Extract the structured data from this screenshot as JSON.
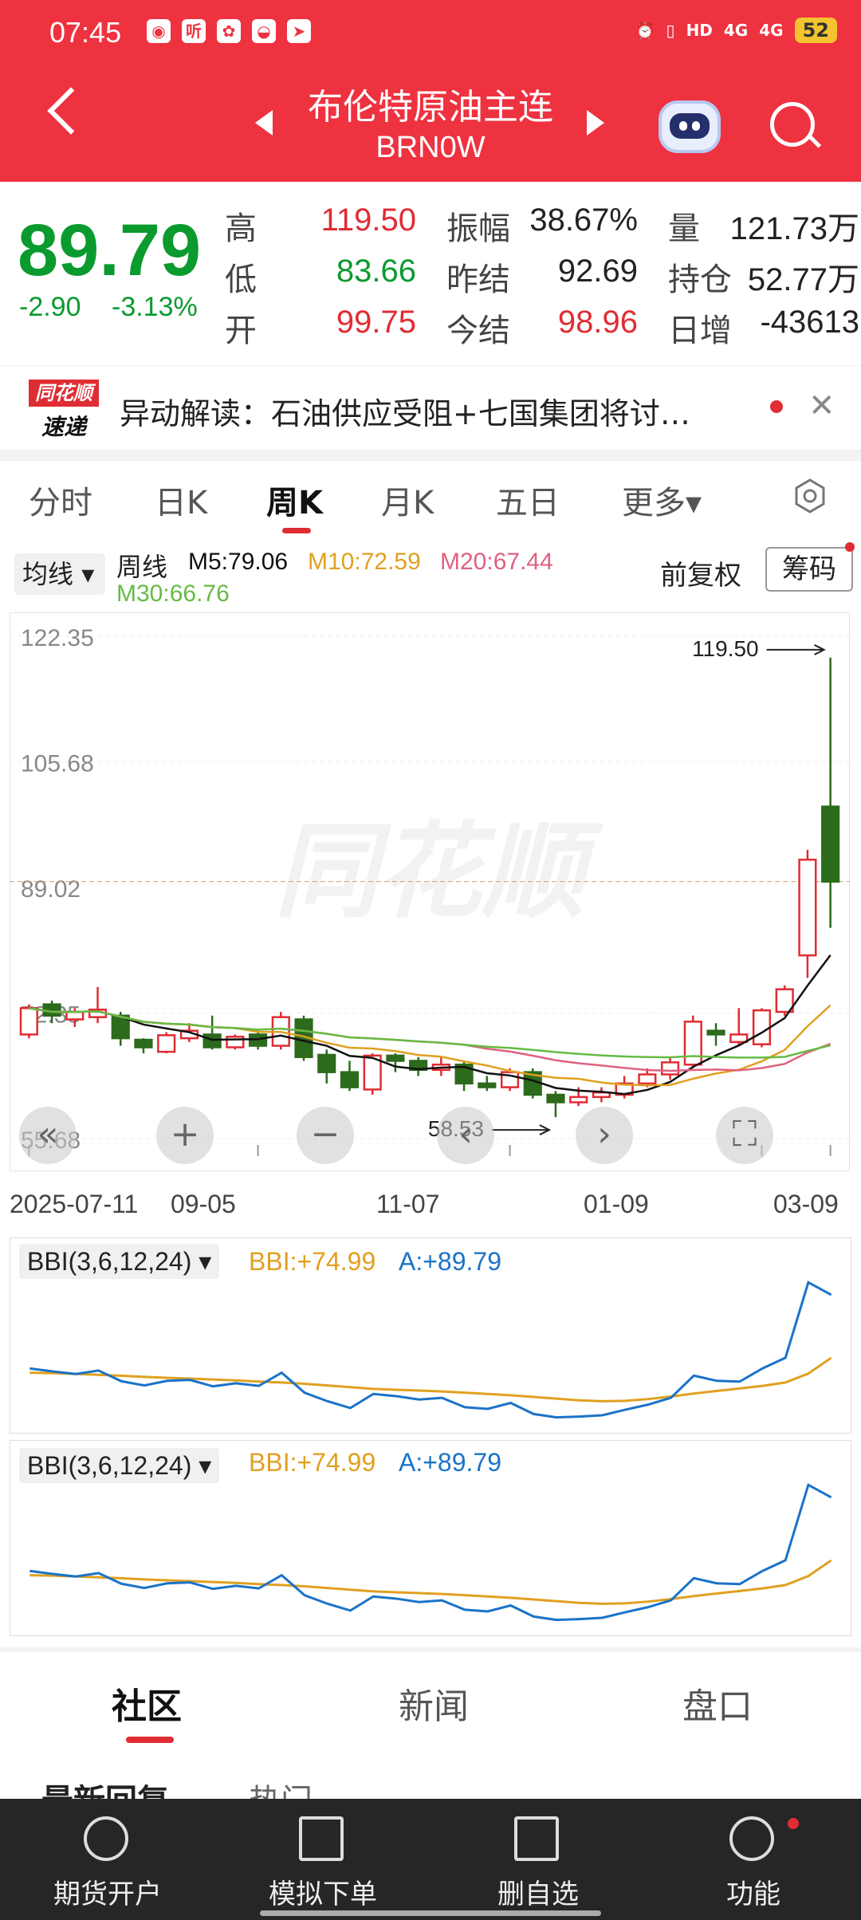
{
  "status_bar": {
    "time": "07:45",
    "battery": "52",
    "signal1": "4G",
    "signal2": "4G",
    "hd": "HD"
  },
  "header": {
    "title": "布伦特原油主连",
    "subtitle": "BRN0W"
  },
  "quote": {
    "price": "89.79",
    "change": "-2.90",
    "change_pct": "-3.13%",
    "fields": [
      {
        "label": "高",
        "value": "119.50",
        "color": "red"
      },
      {
        "label": "振幅",
        "value": "38.67%",
        "color": "black"
      },
      {
        "label": "量",
        "value": "121.73万",
        "color": "black"
      },
      {
        "label": "低",
        "value": "83.66",
        "color": "green"
      },
      {
        "label": "昨结",
        "value": "92.69",
        "color": "black"
      },
      {
        "label": "持仓",
        "value": "52.77万",
        "color": "black"
      },
      {
        "label": "开",
        "value": "99.75",
        "color": "red"
      },
      {
        "label": "今结",
        "value": "98.96",
        "color": "red"
      },
      {
        "label": "日增",
        "value": "-43613",
        "color": "black"
      }
    ]
  },
  "news": {
    "logo_top": "同花顺",
    "logo_bottom": "速递",
    "text": "异动解读：石油供应受阻+七国集团将讨…"
  },
  "tabs": [
    "分时",
    "日K",
    "周K",
    "月K",
    "五日",
    "更多▾"
  ],
  "active_tab": "周K",
  "ma_bar": {
    "button": "均线",
    "period": "周线",
    "m5": "M5:79.06",
    "m10": "M10:72.59",
    "m20": "M20:67.44",
    "m30": "M30:66.76",
    "adjust": "前复权",
    "chip": "筹码"
  },
  "colors": {
    "up": "#e02c33",
    "down": "#2c6a1c",
    "m5": "#111111",
    "m10": "#e0a020",
    "m20": "#e06080",
    "m30": "#66bb44",
    "bbi": "#e0a020",
    "a": "#1a73c8",
    "header": "#ee3240"
  },
  "chart_data": [
    {
      "type": "candlestick",
      "y_ticks": [
        "122.35",
        "105.68",
        "89.02",
        "72.35",
        "55.68"
      ],
      "ylim": [
        55.68,
        122.35
      ],
      "x_labels": [
        "2025-07-11",
        "09-05",
        "11-07",
        "01-09",
        "03-09"
      ],
      "max_label": "119.50",
      "min_label": "58.53",
      "candles": [
        {
          "o": 69.5,
          "c": 73.0,
          "h": 73.5,
          "l": 69.0
        },
        {
          "o": 73.5,
          "c": 72.0,
          "h": 74.0,
          "l": 71.0
        },
        {
          "o": 71.5,
          "c": 72.5,
          "h": 73.0,
          "l": 70.5
        },
        {
          "o": 71.8,
          "c": 72.8,
          "h": 75.8,
          "l": 71.0
        },
        {
          "o": 72.0,
          "c": 69.0,
          "h": 72.5,
          "l": 68.0
        },
        {
          "o": 68.8,
          "c": 67.8,
          "h": 69.0,
          "l": 67.0
        },
        {
          "o": 67.2,
          "c": 69.4,
          "h": 69.8,
          "l": 67.0
        },
        {
          "o": 69.0,
          "c": 70.0,
          "h": 71.0,
          "l": 68.5
        },
        {
          "o": 69.5,
          "c": 67.8,
          "h": 72.0,
          "l": 67.5
        },
        {
          "o": 67.8,
          "c": 69.2,
          "h": 69.5,
          "l": 67.5
        },
        {
          "o": 69.5,
          "c": 68.0,
          "h": 70.0,
          "l": 67.5
        },
        {
          "o": 68.0,
          "c": 71.8,
          "h": 72.5,
          "l": 67.5
        },
        {
          "o": 71.5,
          "c": 66.5,
          "h": 72.0,
          "l": 66.0
        },
        {
          "o": 66.8,
          "c": 64.5,
          "h": 67.5,
          "l": 63.0
        },
        {
          "o": 64.5,
          "c": 62.5,
          "h": 66.0,
          "l": 62.0
        },
        {
          "o": 62.2,
          "c": 66.7,
          "h": 67.0,
          "l": 61.5
        },
        {
          "o": 66.7,
          "c": 66.0,
          "h": 67.0,
          "l": 64.5
        },
        {
          "o": 66.0,
          "c": 64.8,
          "h": 66.5,
          "l": 64.0
        },
        {
          "o": 64.8,
          "c": 65.5,
          "h": 66.5,
          "l": 64.0
        },
        {
          "o": 65.5,
          "c": 63.0,
          "h": 66.0,
          "l": 62.0
        },
        {
          "o": 63.0,
          "c": 62.5,
          "h": 64.0,
          "l": 62.0
        },
        {
          "o": 62.5,
          "c": 64.5,
          "h": 65.0,
          "l": 62.0
        },
        {
          "o": 64.5,
          "c": 61.5,
          "h": 65.0,
          "l": 61.0
        },
        {
          "o": 61.5,
          "c": 60.5,
          "h": 62.0,
          "l": 58.53
        },
        {
          "o": 60.5,
          "c": 61.2,
          "h": 62.5,
          "l": 60.0
        },
        {
          "o": 61.2,
          "c": 61.8,
          "h": 62.5,
          "l": 60.5
        },
        {
          "o": 61.5,
          "c": 63.0,
          "h": 64.0,
          "l": 61.0
        },
        {
          "o": 63.0,
          "c": 64.2,
          "h": 65.0,
          "l": 62.5
        },
        {
          "o": 64.2,
          "c": 65.8,
          "h": 66.5,
          "l": 63.5
        },
        {
          "o": 65.5,
          "c": 71.2,
          "h": 72.0,
          "l": 65.0
        },
        {
          "o": 70.0,
          "c": 69.5,
          "h": 71.0,
          "l": 68.0
        },
        {
          "o": 68.5,
          "c": 69.5,
          "h": 73.0,
          "l": 68.0
        },
        {
          "o": 68.2,
          "c": 72.7,
          "h": 73.0,
          "l": 67.8
        },
        {
          "o": 72.5,
          "c": 75.5,
          "h": 76.0,
          "l": 72.0
        },
        {
          "o": 80.0,
          "c": 92.7,
          "h": 94.0,
          "l": 77.0
        },
        {
          "o": 99.75,
          "c": 89.79,
          "h": 119.5,
          "l": 83.66
        }
      ]
    },
    {
      "type": "line",
      "title": "BBI(3,6,12,24)",
      "series": [
        {
          "name": "BBI",
          "label": "BBI:+74.99",
          "values": [
            71.5,
            71.4,
            71.2,
            71.0,
            70.8,
            70.5,
            70.3,
            70.1,
            69.9,
            69.7,
            69.4,
            69.2,
            68.9,
            68.5,
            68.1,
            67.7,
            67.5,
            67.3,
            67.1,
            66.8,
            66.5,
            66.2,
            65.8,
            65.4,
            65.0,
            64.8,
            64.9,
            65.3,
            65.9,
            66.6,
            67.2,
            67.8,
            68.4,
            69.2,
            71.3,
            74.99
          ]
        },
        {
          "name": "A",
          "label": "A:+89.79",
          "values": [
            72.5,
            71.8,
            71.2,
            72.0,
            69.5,
            68.5,
            69.6,
            69.8,
            68.3,
            69.0,
            68.4,
            71.5,
            66.8,
            64.8,
            63.2,
            66.5,
            66.0,
            65.2,
            65.6,
            63.4,
            63.0,
            64.4,
            61.8,
            61.0,
            61.2,
            61.5,
            62.8,
            64.0,
            65.6,
            70.8,
            69.6,
            69.4,
            72.5,
            75.0,
            92.7,
            89.79
          ]
        }
      ]
    },
    {
      "type": "line",
      "title": "BBI(3,6,12,24)",
      "series": [
        {
          "name": "BBI",
          "label": "BBI:+74.99",
          "values": [
            71.5,
            71.4,
            71.2,
            71.0,
            70.8,
            70.5,
            70.3,
            70.1,
            69.9,
            69.7,
            69.4,
            69.2,
            68.9,
            68.5,
            68.1,
            67.7,
            67.5,
            67.3,
            67.1,
            66.8,
            66.5,
            66.2,
            65.8,
            65.4,
            65.0,
            64.8,
            64.9,
            65.3,
            65.9,
            66.6,
            67.2,
            67.8,
            68.4,
            69.2,
            71.3,
            74.99
          ]
        },
        {
          "name": "A",
          "label": "A:+89.79",
          "values": [
            72.5,
            71.8,
            71.2,
            72.0,
            69.5,
            68.5,
            69.6,
            69.8,
            68.3,
            69.0,
            68.4,
            71.5,
            66.8,
            64.8,
            63.2,
            66.5,
            66.0,
            65.2,
            65.6,
            63.4,
            63.0,
            64.4,
            61.8,
            61.0,
            61.2,
            61.5,
            62.8,
            64.0,
            65.6,
            70.8,
            69.6,
            69.4,
            72.5,
            75.0,
            92.7,
            89.79
          ]
        }
      ]
    }
  ],
  "ind_panels": [
    {
      "title": "BBI(3,6,12,24)",
      "bbi": "BBI:+74.99",
      "a": "A:+89.79"
    },
    {
      "title": "BBI(3,6,12,24)",
      "bbi": "BBI:+74.99",
      "a": "A:+89.79"
    }
  ],
  "bottom_tabs": [
    "社区",
    "新闻",
    "盘口"
  ],
  "peek": {
    "left": "最新回复",
    "right": "热门"
  },
  "nav": [
    "期货开户",
    "模拟下单",
    "删自选",
    "功能"
  ]
}
